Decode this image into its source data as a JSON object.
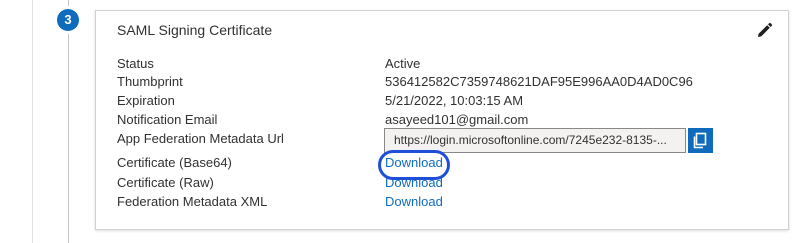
{
  "step": {
    "number": "3"
  },
  "card": {
    "title": "SAML Signing Certificate",
    "rows": [
      {
        "label": "Status",
        "value": "Active"
      },
      {
        "label": "Thumbprint",
        "value": "536412582C7359748621DAF95E996AA0D4AD0C96"
      },
      {
        "label": "Expiration",
        "value": "5/21/2022, 10:03:15 AM"
      },
      {
        "label": "Notification Email",
        "value": "asayeed101@gmail.com"
      },
      {
        "label": "App Federation Metadata Url",
        "value": "https://login.microsoftonline.com/7245e232-8135-..."
      },
      {
        "label": "Certificate (Base64)",
        "value": "Download"
      },
      {
        "label": "Certificate (Raw)",
        "value": "Download"
      },
      {
        "label": "Federation Metadata XML",
        "value": "Download"
      }
    ]
  },
  "icons": {
    "edit": "pencil-icon",
    "copy": "copy-icon"
  },
  "colors": {
    "accent": "#0f6cbd",
    "highlight": "#1f4fd8"
  }
}
